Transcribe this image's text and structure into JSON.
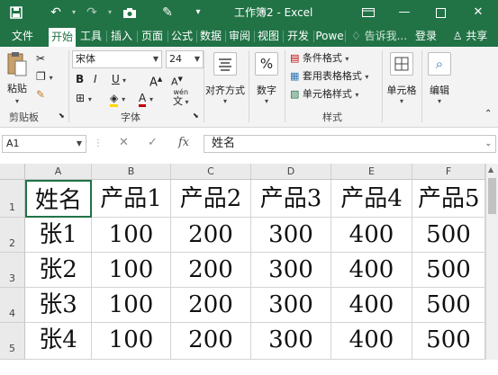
{
  "titlebar": {
    "title": "工作簿2 - Excel",
    "save_icon": "save-icon",
    "undo_icon": "undo-icon",
    "redo_icon": "redo-icon",
    "camera_icon": "camera-icon",
    "format_painter_icon": "brush-icon"
  },
  "tabs": [
    "文件",
    "开始",
    "工具",
    "插入",
    "页面",
    "公式",
    "数据",
    "审阅",
    "视图",
    "开发",
    "Powe"
  ],
  "tell_me": "告诉我...",
  "login": "登录",
  "share": "共享",
  "ribbon": {
    "clipboard": {
      "paste": "粘贴",
      "label": "剪贴板"
    },
    "font": {
      "name": "宋体",
      "size": "24",
      "bold": "B",
      "italic": "I",
      "underline": "U",
      "label": "字体",
      "wen": "wén"
    },
    "align": {
      "label": "对齐方式"
    },
    "number": {
      "label": "数字",
      "symbol": "%"
    },
    "styles": {
      "cond": "条件格式",
      "table": "套用表格格式",
      "cell": "单元格样式",
      "label": "样式"
    },
    "cells": {
      "label": "单元格"
    },
    "editing": {
      "label": "编辑"
    }
  },
  "formula": {
    "namebox": "A1",
    "fx": "fx",
    "value": "姓名"
  },
  "columns": [
    "A",
    "B",
    "C",
    "D",
    "E",
    "F"
  ],
  "rows": [
    {
      "num": "1",
      "cells": [
        "姓名",
        "产品1",
        "产品2",
        "产品3",
        "产品4",
        "产品5"
      ]
    },
    {
      "num": "2",
      "cells": [
        "张1",
        "100",
        "200",
        "300",
        "400",
        "500"
      ]
    },
    {
      "num": "3",
      "cells": [
        "张2",
        "100",
        "200",
        "300",
        "400",
        "500"
      ]
    },
    {
      "num": "4",
      "cells": [
        "张3",
        "100",
        "200",
        "300",
        "400",
        "500"
      ]
    },
    {
      "num": "5",
      "cells": [
        "张4",
        "100",
        "200",
        "300",
        "400",
        "500"
      ]
    }
  ]
}
